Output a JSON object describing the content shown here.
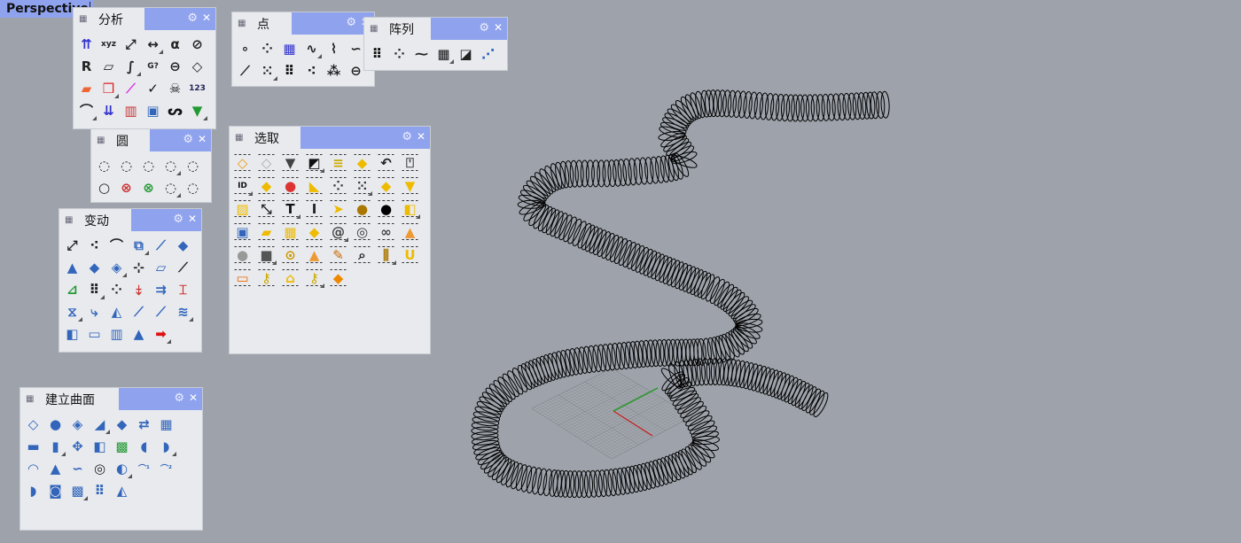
{
  "viewport": {
    "label": "Perspective"
  },
  "colors": {
    "toolbar_header": "#8ea2ee",
    "panel_bg": "#e8eaee",
    "viewport_bg": "#9ea3ab",
    "x_axis": "#c81e1e",
    "y_axis": "#1e9a1e"
  },
  "panels": [
    {
      "id": "analyze",
      "title": "分析",
      "cols": 6,
      "icons": [
        [
          "direction-icon",
          "⇈",
          "#33c"
        ],
        [
          "xyz-point-icon",
          "xyz",
          "#222"
        ],
        [
          "length-icon",
          "⤢",
          "#222"
        ],
        [
          "distance-icon",
          "↔",
          "#222"
        ],
        [
          "angle-icon",
          "α",
          "#222"
        ],
        [
          "diameter-icon",
          "⊘",
          "#222"
        ],
        [
          "radius-icon",
          "R",
          "#222"
        ],
        [
          "bounding-box-icon",
          "▱",
          "#222"
        ],
        [
          "curvature-graph-icon",
          "∫",
          "#222"
        ],
        [
          "geometric-continuity-icon",
          "G?",
          "#222"
        ],
        [
          "deviation-icon",
          "⊖",
          "#222"
        ],
        [
          "area-icon",
          "◇",
          "#222"
        ],
        [
          "zebra-icon",
          "▰",
          "#e63"
        ],
        [
          "curvature-analysis-icon",
          "❒",
          "#d22"
        ],
        [
          "point-check-icon",
          "⟋",
          "#d3d"
        ],
        [
          "check-icon",
          "✓",
          "#111"
        ],
        [
          "bad-objects-icon",
          "☠",
          "#111"
        ],
        [
          "numbering-icon",
          "123",
          "#225"
        ],
        [
          "curvature-circle-icon",
          "⌒",
          "#222"
        ],
        [
          "draft-angle-icon",
          "⇊",
          "#33c"
        ],
        [
          "histogram-icon",
          "▥",
          "#c33"
        ],
        [
          "mesh-collision-icon",
          "▣",
          "#36b"
        ],
        [
          "loop-icon",
          "ᔕ",
          "#111"
        ],
        [
          "paint-icon",
          "▼",
          "#293"
        ]
      ]
    },
    {
      "id": "point",
      "title": "点",
      "cols": 7,
      "icons": [
        [
          "single-point-icon",
          "∘",
          "#222"
        ],
        [
          "multiple-points-icon",
          "⁘",
          "#222"
        ],
        [
          "point-grid-icon",
          "▦",
          "#33c"
        ],
        [
          "curve-points-icon",
          "∿",
          "#222"
        ],
        [
          "divide-curve-icon",
          "⌇",
          "#222"
        ],
        [
          "extract-points-icon",
          "∽",
          "#222"
        ],
        [
          "",
          "",
          " "
        ],
        [
          "points-on-curve-icon",
          "⟋",
          "#222"
        ],
        [
          "point-cloud-icon",
          "⁙",
          "#222"
        ],
        [
          "grid-dots-icon",
          "⠿",
          "#111"
        ],
        [
          "scatter-points-icon",
          "⁖",
          "#222"
        ],
        [
          "random-points-icon",
          "⁂",
          "#222"
        ],
        [
          "ellipse-points-icon",
          "⊖",
          "#222"
        ]
      ]
    },
    {
      "id": "array",
      "title": "阵列",
      "cols": 6,
      "icons": [
        [
          "rect-array-icon",
          "⠿",
          "#111"
        ],
        [
          "polar-array-icon",
          "⁘",
          "#222"
        ],
        [
          "curve-array-icon",
          "⁓",
          "#222"
        ],
        [
          "box-array-icon",
          "▦",
          "#111"
        ],
        [
          "surface-array-icon",
          "◪",
          "#222"
        ],
        [
          "linear-array-icon",
          "⋰",
          "#36b"
        ]
      ]
    },
    {
      "id": "circle",
      "title": "圆",
      "cols": 5,
      "icons": [
        [
          "circle-center-icon",
          "◌",
          "#222"
        ],
        [
          "circle-2pt-icon",
          "◌",
          "#222"
        ],
        [
          "circle-3pt-icon",
          "◌",
          "#222"
        ],
        [
          "circle-tangent-icon",
          "◌",
          "#222"
        ],
        [
          "circle-deformable-icon",
          "◌",
          "#222"
        ],
        [
          "circle-icon",
          "○",
          "#222"
        ],
        [
          "circle-tan-curve-icon",
          "⊗",
          "#c33"
        ],
        [
          "circle-tan-3-icon",
          "⊗",
          "#293"
        ],
        [
          "circle-fit-icon",
          "◌",
          "#222"
        ],
        [
          "circle-points-icon",
          "◌",
          "#222"
        ]
      ]
    },
    {
      "id": "select",
      "title": "选取",
      "cols": 8,
      "sel": true,
      "icons": [
        [
          "select-all-icon",
          "◇",
          "#e90"
        ],
        [
          "select-none-icon",
          "◇",
          "#aaa"
        ],
        [
          "select-filter-icon",
          "▼",
          "#444"
        ],
        [
          "invert-selection-icon",
          "◩",
          "#111"
        ],
        [
          "select-layer-icon",
          "≡",
          "#ca0"
        ],
        [
          "select-last-icon",
          "◆",
          "#eb0"
        ],
        [
          "select-previous-icon",
          "↶",
          "#222"
        ],
        [
          "select-light-icon",
          "⍞",
          "#444"
        ],
        [
          "select-id-icon",
          "ID",
          "#111"
        ],
        [
          "select-solid-icon",
          "◆",
          "#eb0"
        ],
        [
          "select-color-icon",
          "●",
          "#d33"
        ],
        [
          "select-surface-icon",
          "◣",
          "#eb0"
        ],
        [
          "select-points-icon",
          "⁘",
          "#333"
        ],
        [
          "select-point-cloud-icon",
          "⁙",
          "#333"
        ],
        [
          "select-polysurface-icon",
          "◆",
          "#eb0"
        ],
        [
          "select-cone-icon",
          "▼",
          "#eb0"
        ],
        [
          "select-hatch-icon",
          "▨",
          "#eb0"
        ],
        [
          "select-dimension-icon",
          "⤡",
          "#222"
        ],
        [
          "select-text-icon",
          "T",
          "#111"
        ],
        [
          "select-annotation-icon",
          "I",
          "#222"
        ],
        [
          "select-leader-icon",
          "➤",
          "#eb0"
        ],
        [
          "select-group-icon",
          "●",
          "#a70"
        ],
        [
          "select-render-icon",
          "●",
          "#000"
        ],
        [
          "select-open-icon",
          "◧",
          "#eb0"
        ],
        [
          "select-mesh-icon",
          "▣",
          "#36b"
        ],
        [
          "select-planar-icon",
          "▰",
          "#eb0"
        ],
        [
          "select-grid-icon",
          "▦",
          "#eb0"
        ],
        [
          "select-box-icon",
          "◆",
          "#eb0"
        ],
        [
          "select-spiral-icon",
          "@",
          "#444"
        ],
        [
          "select-block-icon",
          "◎",
          "#333"
        ],
        [
          "select-chain-icon",
          "∞",
          "#444"
        ],
        [
          "select-pyramid-icon",
          "▲",
          "#e93"
        ],
        [
          "select-sphere-icon",
          "●",
          "#999"
        ],
        [
          "select-cube-icon",
          "■",
          "#555"
        ],
        [
          "select-camera-icon",
          "⊙",
          "#c90"
        ],
        [
          "select-scene-icon",
          "▲",
          "#e93"
        ],
        [
          "select-brush-icon",
          "✎",
          "#c60"
        ],
        [
          "select-zoom-icon",
          "⌕",
          "#222"
        ],
        [
          "select-fence-icon",
          "⫼",
          "#a70"
        ],
        [
          "select-u-icon",
          "U",
          "#eb0"
        ],
        [
          "select-bbox-icon",
          "▭",
          "#e60"
        ],
        [
          "select-key-icon",
          "⚷",
          "#ca0"
        ],
        [
          "select-tag-icon",
          "⌂",
          "#eb0"
        ],
        [
          "select-keys-icon",
          "⚷",
          "#ca0"
        ],
        [
          "select-cube-red-icon",
          "◆",
          "#e80"
        ]
      ]
    },
    {
      "id": "transform",
      "title": "变动",
      "cols": 6,
      "icons": [
        [
          "move-icon",
          "⤢",
          "#222"
        ],
        [
          "copy-icon",
          "⁖",
          "#222"
        ],
        [
          "rotate-icon",
          "⌒",
          "#222"
        ],
        [
          "group-icon",
          "⧉",
          "#36b"
        ],
        [
          "scale-1d-icon",
          "⟋",
          "#36b"
        ],
        [
          "box-edit-icon",
          "◆",
          "#36b"
        ],
        [
          "mirror-icon",
          "▲",
          "#36b"
        ],
        [
          "orient-icon",
          "◆",
          "#36b"
        ],
        [
          "scale-icon",
          "◈",
          "#36b"
        ],
        [
          "align-icon",
          "⊹",
          "#222"
        ],
        [
          "shear-icon",
          "▱",
          "#36b"
        ],
        [
          "planar-icon",
          "⟋",
          "#222"
        ],
        [
          "set-points-icon",
          "⊿",
          "#293"
        ],
        [
          "array-icon",
          "⠿",
          "#222"
        ],
        [
          "polar-icon",
          "⁘",
          "#222"
        ],
        [
          "project-icon",
          "⤈",
          "#c33"
        ],
        [
          "flow-icon",
          "⇉",
          "#36b"
        ],
        [
          "bend-icon",
          "⌶",
          "#c33"
        ],
        [
          "twist-icon",
          "⧖",
          "#36b"
        ],
        [
          "bend-flow-icon",
          "⤷",
          "#36b"
        ],
        [
          "taper-icon",
          "◭",
          "#36b"
        ],
        [
          "flow-surface-icon",
          "⟋",
          "#36b"
        ],
        [
          "splop-icon",
          "⟋",
          "#36b"
        ],
        [
          "smooth-icon",
          "≋",
          "#36b"
        ],
        [
          "cage-edit-icon",
          "◧",
          "#36b"
        ],
        [
          "soft-move-icon",
          "▭",
          "#36b"
        ],
        [
          "film-icon",
          "▥",
          "#36b"
        ],
        [
          "maelstrom-icon",
          "▲",
          "#36b"
        ],
        [
          "red-arrow-icon",
          "➡",
          "#d11"
        ]
      ]
    },
    {
      "id": "surface",
      "title": "建立曲面",
      "cols": 7,
      "icons": [
        [
          "corner-surface-icon",
          "◇",
          "#36b"
        ],
        [
          "edge-surface-icon",
          "●",
          "#36b"
        ],
        [
          "patch-icon",
          "◈",
          "#36b"
        ],
        [
          "loft-icon",
          "◢",
          "#36b"
        ],
        [
          "sweep-icon",
          "◆",
          "#36b"
        ],
        [
          "rail-icon",
          "⇄",
          "#36b"
        ],
        [
          "network-icon",
          "▦",
          "#36b"
        ],
        [
          "extrude-icon",
          "▬",
          "#36b"
        ],
        [
          "rectangle-plane-icon",
          "▮",
          "#36b"
        ],
        [
          "pipe-icon",
          "✥",
          "#36b"
        ],
        [
          "extrude-curve-icon",
          "◧",
          "#36b"
        ],
        [
          "deviation-surface-icon",
          "▩",
          "#293"
        ],
        [
          "revolve-icon",
          "◖",
          "#36b"
        ],
        [
          "rail-revolve-icon",
          "◗",
          "#36b"
        ],
        [
          "dome-icon",
          "◠",
          "#36b"
        ],
        [
          "cone-icon",
          "▲",
          "#36b"
        ],
        [
          "blend-icon",
          "∽",
          "#36b"
        ],
        [
          "torus-icon",
          "◎",
          "#222"
        ],
        [
          "offset-icon",
          "◐",
          "#36b"
        ],
        [
          "sweep1-icon",
          "⌒¹",
          "#36b"
        ],
        [
          "sweep2-icon",
          "⌒²",
          "#36b"
        ],
        [
          "fillet-icon",
          "◗",
          "#36b"
        ],
        [
          "tube-icon",
          "◙",
          "#36b"
        ],
        [
          "heightfield-icon",
          "▩",
          "#36b"
        ],
        [
          "point-grid-surface-icon",
          "⠿",
          "#36b"
        ],
        [
          "drape-icon",
          "◭",
          "#36b"
        ]
      ]
    }
  ]
}
